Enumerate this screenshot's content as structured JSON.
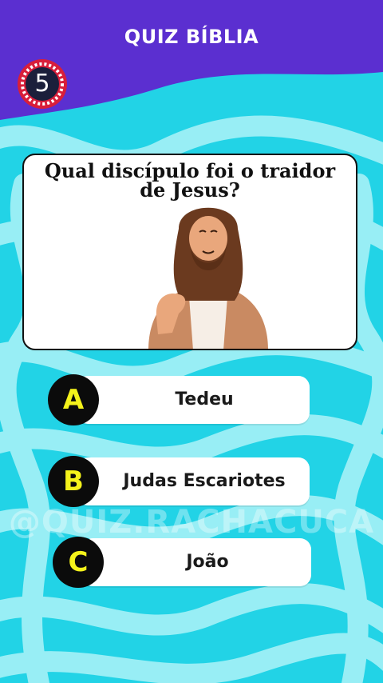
{
  "header": {
    "title": "QUIZ BÍBLIA"
  },
  "timer": {
    "value": "5"
  },
  "question": {
    "text": "Qual discípulo foi o traidor de Jesus?"
  },
  "options": [
    {
      "letter": "A",
      "label": "Tedeu"
    },
    {
      "letter": "B",
      "label": "Judas Escariotes"
    },
    {
      "letter": "C",
      "label": "João"
    }
  ],
  "watermark": {
    "text": "@QUIZ.RACHACUCA"
  },
  "colors": {
    "header_bg": "#5b2fd0",
    "background": "#22d3e6",
    "wave": "#9ff0f6",
    "letter": "#f4f21b",
    "circle": "#0b0b0b"
  },
  "icons": {
    "timer": "countdown-ring-icon",
    "illustration": "jesus-illustration"
  }
}
